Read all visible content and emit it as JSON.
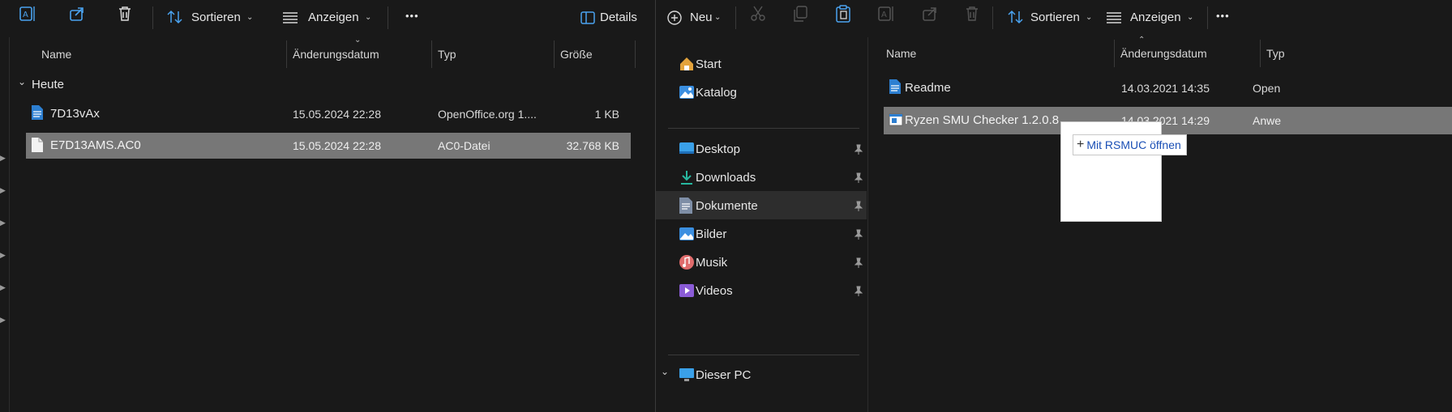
{
  "left_pane": {
    "toolbar": {
      "sort_label": "Sortieren",
      "view_label": "Anzeigen",
      "more_label": "•••",
      "details_label": "Details"
    },
    "columns": {
      "name": "Name",
      "modified": "Änderungsdatum",
      "type": "Typ",
      "size": "Größe"
    },
    "group_label": "Heute",
    "files": [
      {
        "name": "7D13vAx",
        "modified": "15.05.2024 22:28",
        "type": "OpenOffice.org 1....",
        "size": "1 KB"
      },
      {
        "name": "E7D13AMS.AC0",
        "modified": "15.05.2024 22:28",
        "type": "AC0-Datei",
        "size": "32.768 KB"
      }
    ]
  },
  "right_pane": {
    "toolbar": {
      "new_label": "Neu",
      "sort_label": "Sortieren",
      "view_label": "Anzeigen",
      "more_label": "•••"
    },
    "nav": {
      "start": "Start",
      "gallery": "Katalog",
      "desktop": "Desktop",
      "downloads": "Downloads",
      "documents": "Dokumente",
      "pictures": "Bilder",
      "music": "Musik",
      "videos": "Videos",
      "this_pc": "Dieser PC"
    },
    "columns": {
      "name": "Name",
      "modified": "Änderungsdatum",
      "type": "Typ"
    },
    "files": [
      {
        "name": "Readme",
        "modified": "14.03.2021 14:35",
        "type": "Open"
      },
      {
        "name": "Ryzen SMU Checker 1.2.0.8",
        "modified": "14.03.2021 14:29",
        "type": "Anwe"
      }
    ],
    "drag_tooltip": "Mit RSMUC öffnen"
  },
  "colors": {
    "background": "#191919",
    "selected_row": "#777777",
    "nav_selected": "#2d2d2d",
    "tooltip_text": "#1a4fb5",
    "accent_blue": "#4aa3f0"
  }
}
